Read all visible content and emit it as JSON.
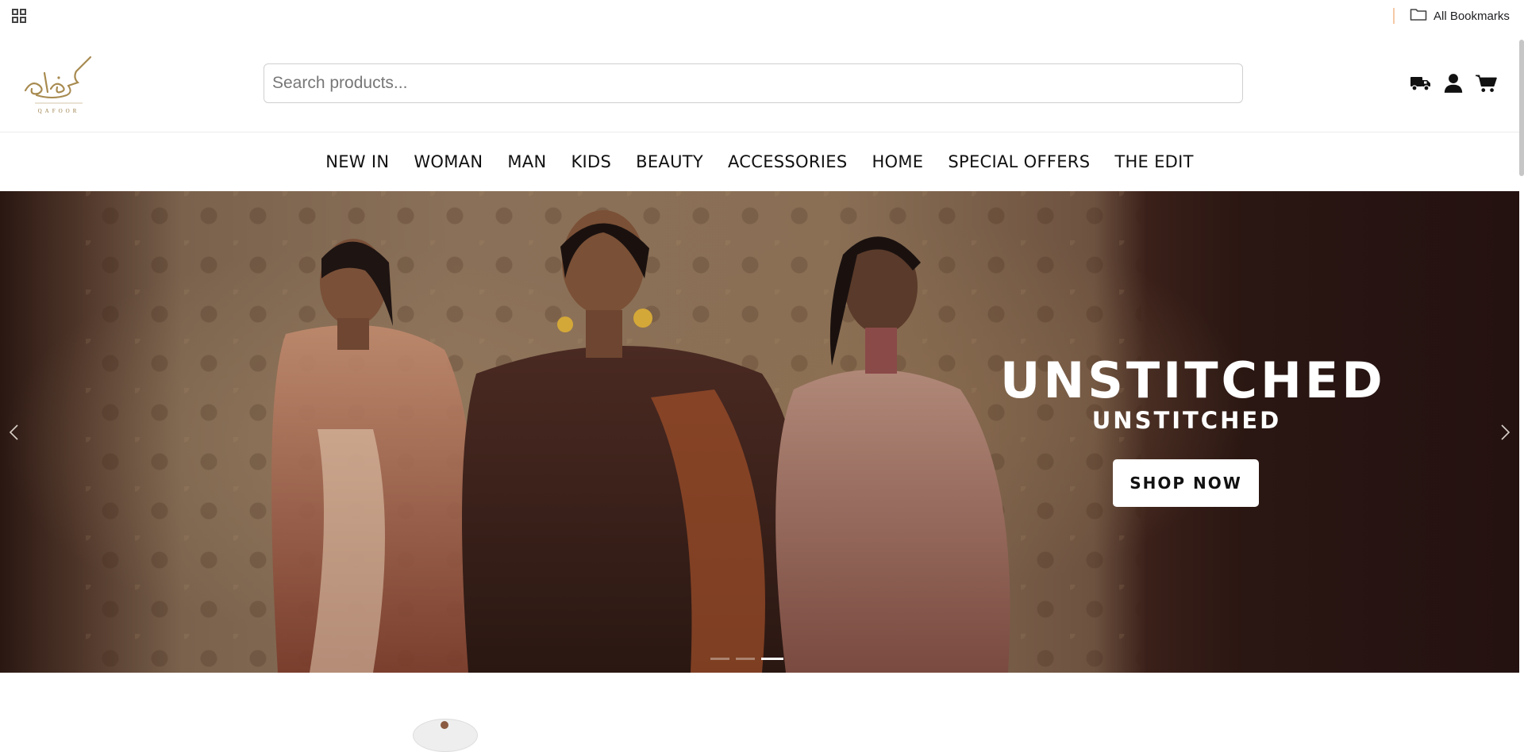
{
  "bookmarks_bar": {
    "all_bookmarks_label": "All Bookmarks"
  },
  "header": {
    "logo_text": "كافور",
    "logo_subtext": "QAFOOR",
    "search": {
      "placeholder": "Search products...",
      "value": ""
    },
    "icons": [
      "truck-icon",
      "user-icon",
      "cart-icon"
    ]
  },
  "nav": {
    "items": [
      {
        "label": "NEW IN"
      },
      {
        "label": "WOMAN"
      },
      {
        "label": "MAN"
      },
      {
        "label": "KIDS"
      },
      {
        "label": "BEAUTY"
      },
      {
        "label": "ACCESSORIES"
      },
      {
        "label": "HOME"
      },
      {
        "label": "SPECIAL OFFERS"
      },
      {
        "label": "THE EDIT"
      }
    ]
  },
  "hero": {
    "title": "UNSTITCHED",
    "subtitle": "UNSTITCHED",
    "button_label": "SHOP NOW",
    "slides_total": 3,
    "active_slide": 3
  },
  "colors": {
    "logo_gold": "#a78a4f",
    "hero_dark": "#241211",
    "hero_warm": "#8a7058",
    "bookmark_separator": "#f5c9a6"
  }
}
